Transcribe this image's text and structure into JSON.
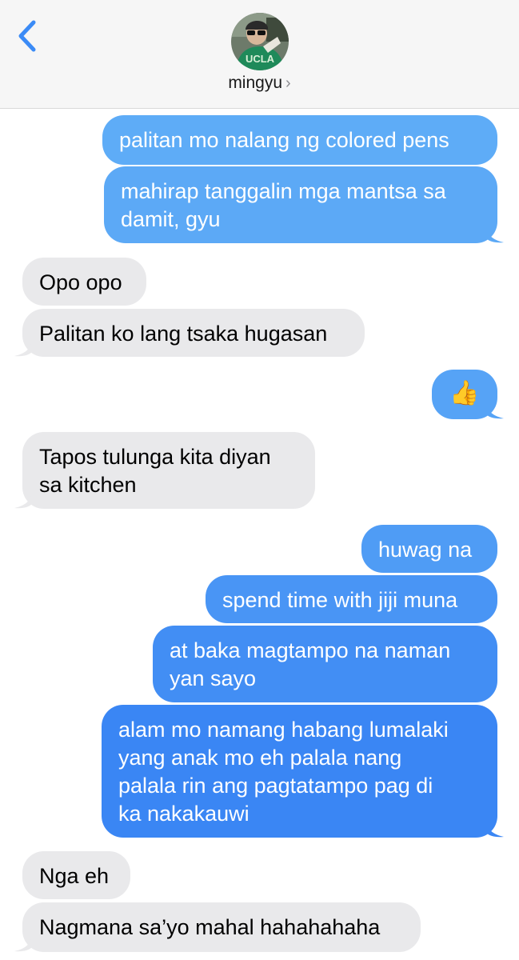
{
  "contact": {
    "name": "mingyu",
    "chevron": "›",
    "avatar_text": "UCLA"
  },
  "icons": {
    "back": "chevron-left-icon",
    "disclosure": "chevron-right-icon"
  },
  "colors": {
    "accent": "#3b8bf6",
    "outgoing_top": "#5eacf7",
    "outgoing_bottom": "#3a84f4",
    "incoming": "#e9e9eb",
    "header_bg": "#f6f6f6"
  },
  "messages": [
    {
      "direction": "outgoing",
      "text": "palitan mo nalang ng colored pens"
    },
    {
      "direction": "outgoing",
      "lines": [
        "mahirap tanggalin mga mantsa sa",
        "damit, gyu"
      ]
    },
    {
      "direction": "incoming",
      "text": "Opo opo"
    },
    {
      "direction": "incoming",
      "text": "Palitan ko lang tsaka hugasan"
    },
    {
      "direction": "outgoing",
      "text": "👍"
    },
    {
      "direction": "incoming",
      "lines": [
        "Tapos tulunga kita diyan",
        "sa kitchen"
      ]
    },
    {
      "direction": "outgoing",
      "text": "huwag na"
    },
    {
      "direction": "outgoing",
      "text": "spend time with jiji muna"
    },
    {
      "direction": "outgoing",
      "lines": [
        "at baka magtampo na naman",
        "yan sayo"
      ]
    },
    {
      "direction": "outgoing",
      "lines": [
        "alam mo namang habang lumalaki",
        "yang anak mo eh palala nang",
        "palala rin ang pagtatampo pag di",
        "ka nakakauwi"
      ]
    },
    {
      "direction": "incoming",
      "text": "Nga eh"
    },
    {
      "direction": "incoming",
      "text": "Nagmana sa’yo mahal hahahahaha"
    }
  ]
}
